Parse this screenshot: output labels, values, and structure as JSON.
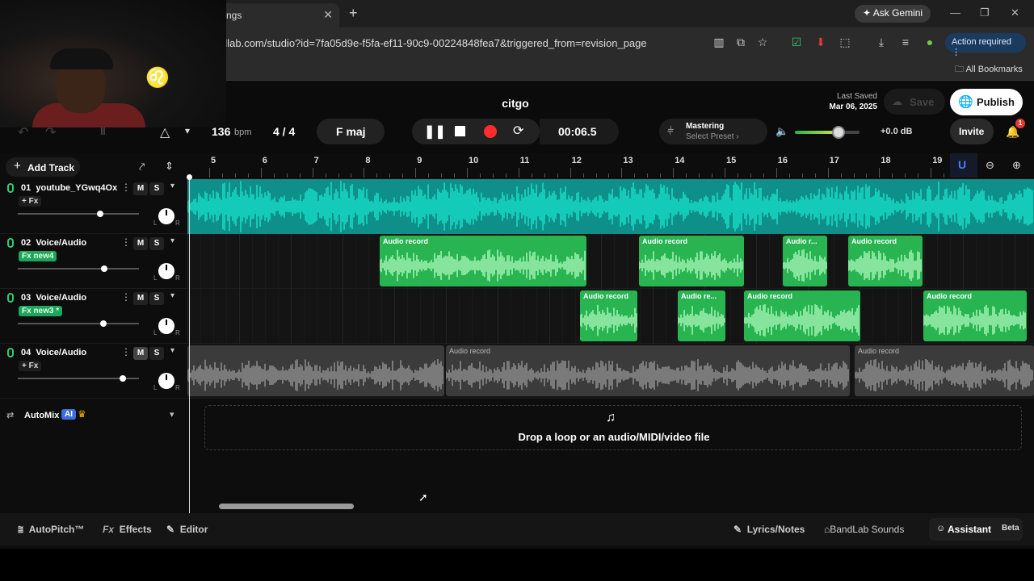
{
  "browser": {
    "tab_title": "ngs",
    "url": "dlab.com/studio?id=7fa05d9e-f5fa-ef11-90c9-00224848fea7&triggered_from=revision_page",
    "ask_gemini": "Ask Gemini",
    "action_required": "Action required",
    "all_bookmarks": "All Bookmarks"
  },
  "header": {
    "project_title": "citgo",
    "last_saved_label": "Last Saved",
    "last_saved_date": "Mar 06, 2025",
    "save_label": "Save",
    "publish_label": "Publish",
    "invite_label": "Invite",
    "notification_count": "1"
  },
  "transport": {
    "bpm_value": "136",
    "bpm_unit": "bpm",
    "time_sig": "4 / 4",
    "key": "F maj",
    "time": "00:06.5",
    "mastering_label": "Mastering",
    "mastering_preset": "Select Preset ›",
    "master_volume": "+0.0 dB"
  },
  "toolbar": {
    "add_track": "Add Track"
  },
  "ruler": {
    "ticks": [
      "5",
      "6",
      "7",
      "8",
      "9",
      "10",
      "11",
      "12",
      "13",
      "14",
      "15",
      "16",
      "17",
      "18",
      "19"
    ]
  },
  "tracks": [
    {
      "number": "01",
      "name": "youtube_YGwq4Ox...",
      "fx": "+ Fx",
      "mute": "M",
      "solo": "S"
    },
    {
      "number": "02",
      "name": "Voice/Audio",
      "fx": "Fx new4",
      "mute": "M",
      "solo": "S"
    },
    {
      "number": "03",
      "name": "Voice/Audio",
      "fx": "Fx new3 *",
      "mute": "M",
      "solo": "S"
    },
    {
      "number": "04",
      "name": "Voice/Audio",
      "fx": "+ Fx",
      "mute": "M",
      "solo": "S"
    }
  ],
  "clips": {
    "track2": [
      "Audio record",
      "Audio record",
      "Audio r...",
      "Audio record"
    ],
    "track3": [
      "Audio record",
      "Audio re...",
      "Audio record",
      "Audio record"
    ],
    "track4": [
      "Audio record",
      "Audio record"
    ]
  },
  "automix": {
    "label": "AutoMix",
    "badge": "AI"
  },
  "dropzone": {
    "text": "Drop a loop or an audio/MIDI/video file"
  },
  "bottom": {
    "autopitch": "AutoPitch™",
    "effects": "Effects",
    "editor": "Editor",
    "lyrics": "Lyrics/Notes",
    "sounds": "BandLab Sounds",
    "assistant": "Assistant",
    "beta": "Beta"
  },
  "colors": {
    "accent_green": "#27b451",
    "track1_wave": "#16d9c4",
    "record_red": "#ff2d2d"
  }
}
